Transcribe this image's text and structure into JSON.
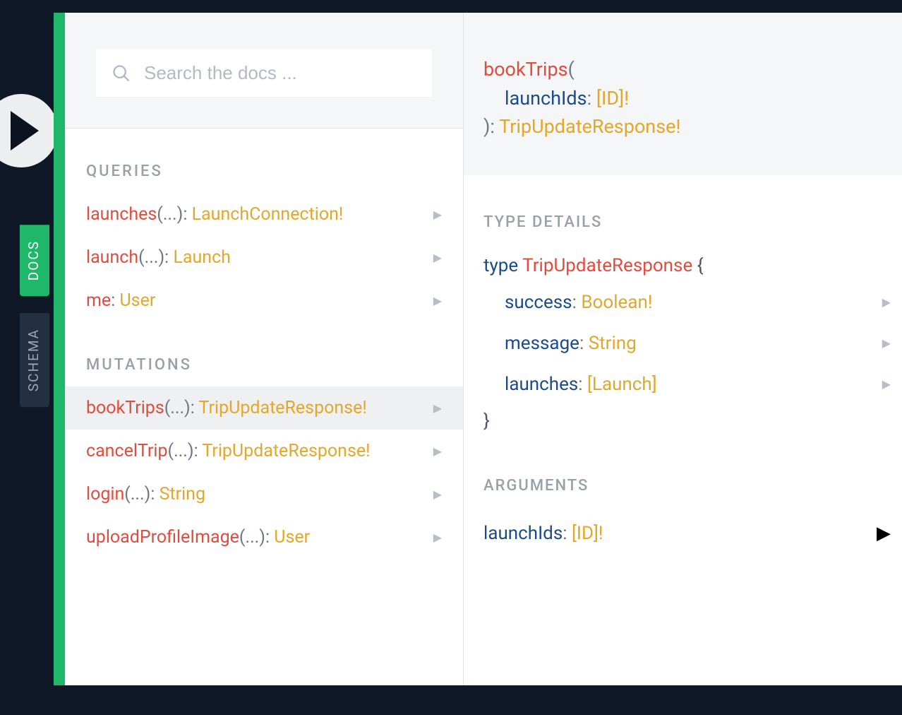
{
  "sideTabs": {
    "docs": "DOCS",
    "schema": "SCHEMA"
  },
  "search": {
    "placeholder": "Search the docs ..."
  },
  "sections": {
    "queries": {
      "label": "QUERIES",
      "items": [
        {
          "name": "launches",
          "args": "(...)",
          "ret": "LaunchConnection!"
        },
        {
          "name": "launch",
          "args": "(...)",
          "ret": "Launch"
        },
        {
          "name": "me",
          "args": "",
          "ret": "User"
        }
      ]
    },
    "mutations": {
      "label": "MUTATIONS",
      "items": [
        {
          "name": "bookTrips",
          "args": "(...)",
          "ret": "TripUpdateResponse!",
          "selected": true
        },
        {
          "name": "cancelTrip",
          "args": "(...)",
          "ret": "TripUpdateResponse!"
        },
        {
          "name": "login",
          "args": "(...)",
          "ret": "String"
        },
        {
          "name": "uploadProfileImage",
          "args": "(...)",
          "ret": "User"
        }
      ]
    }
  },
  "detail": {
    "signature": {
      "name": "bookTrips",
      "args": [
        {
          "name": "launchIds",
          "type": "[ID]!"
        }
      ],
      "returnType": "TripUpdateResponse!"
    },
    "typeDetailsLabel": "TYPE DETAILS",
    "typeDef": {
      "keyword": "type",
      "name": "TripUpdateResponse",
      "openBrace": "{",
      "closeBrace": "}",
      "fields": [
        {
          "name": "success",
          "type": "Boolean!"
        },
        {
          "name": "message",
          "type": "String"
        },
        {
          "name": "launches",
          "type": "[Launch]"
        }
      ]
    },
    "argumentsLabel": "ARGUMENTS",
    "arguments": [
      {
        "name": "launchIds",
        "type": "[ID]!"
      }
    ]
  },
  "glyph": {
    "chevron": "▶"
  }
}
